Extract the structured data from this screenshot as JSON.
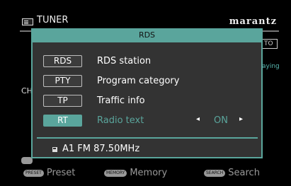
{
  "header": {
    "source_icon": "tuner-icon",
    "source_label": "TUNER",
    "brand": "marantz"
  },
  "background": {
    "right_box_text": "TO",
    "right_text": "aying",
    "left_text": "CH"
  },
  "footer": {
    "items": [
      {
        "badge": "PRESET",
        "label": "Preset"
      },
      {
        "badge": "MEMORY",
        "label": "Memory"
      },
      {
        "badge": "SEARCH",
        "label": "Search"
      }
    ]
  },
  "dialog": {
    "title": "RDS",
    "items": [
      {
        "key": "RDS",
        "label": "RDS station"
      },
      {
        "key": "PTY",
        "label": "Program category"
      },
      {
        "key": "TP",
        "label": "Traffic info"
      },
      {
        "key": "RT",
        "label": "Radio text",
        "value": "ON",
        "selected": true
      }
    ],
    "status_icon": "radio-icon",
    "status_text": "A1 FM 87.50MHz"
  },
  "colors": {
    "accent": "#5aa59c",
    "background": "#000000",
    "dialog": "#333333"
  }
}
